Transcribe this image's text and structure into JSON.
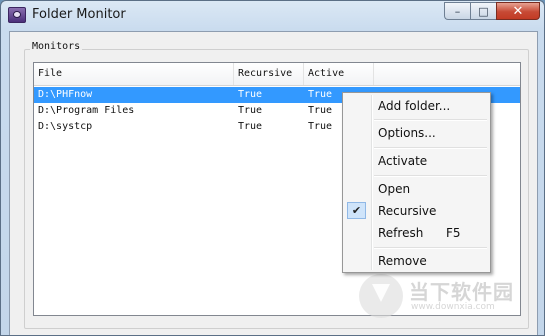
{
  "window": {
    "title": "Folder Monitor"
  },
  "caption_buttons": {
    "minimize": "–",
    "maximize": "□",
    "close": "✕"
  },
  "group": {
    "label": "Monitors"
  },
  "table": {
    "columns": [
      "File",
      "Recursive",
      "Active"
    ],
    "rows": [
      {
        "file": "D:\\PHFnow",
        "recursive": "True",
        "active": "True",
        "selected": true
      },
      {
        "file": "D:\\Program Files",
        "recursive": "True",
        "active": "True",
        "selected": false
      },
      {
        "file": "D:\\systcp",
        "recursive": "True",
        "active": "True",
        "selected": false
      }
    ]
  },
  "context_menu": {
    "add_folder": "Add folder...",
    "options": "Options...",
    "activate": "Activate",
    "open": "Open",
    "recursive": "Recursive",
    "recursive_checked": true,
    "refresh": "Refresh",
    "refresh_shortcut": "F5",
    "remove": "Remove"
  },
  "watermark": {
    "text": "当下软件园",
    "subtext": "www.downxia.com"
  },
  "colors": {
    "selection": "#3399ff",
    "close_button": "#c74a35"
  }
}
